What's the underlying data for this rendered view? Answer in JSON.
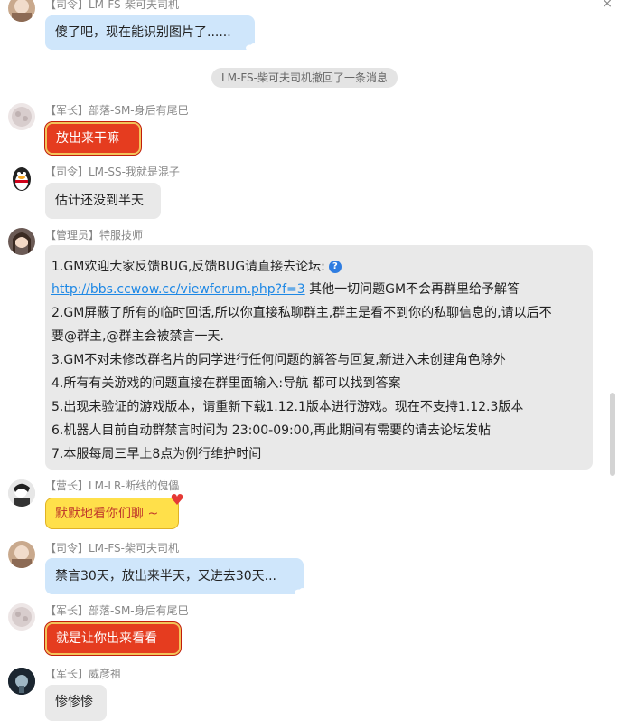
{
  "window": {
    "close_symbol": "×"
  },
  "notice": "LM-FS-柴可夫司机撤回了一条消息",
  "messages": [
    {
      "sender": "【司令】LM-FS-柴可夫司机",
      "text": "傻了吧，现在能识别图片了......"
    },
    {
      "sender": "【军长】部落-SM-身后有尾巴",
      "text": "放出来干嘛"
    },
    {
      "sender": "【司令】LM-SS-我就是混子",
      "text": "估计还没到半天"
    },
    {
      "sender": "【管理员】特服技师"
    },
    {
      "sender": "【营长】LM-LR-断线的傀儡",
      "text": "默默地看你们聊 ~"
    },
    {
      "sender": "【司令】LM-FS-柴可夫司机",
      "text": "禁言30天，放出来半天，又进去30天..."
    },
    {
      "sender": "【军长】部落-SM-身后有尾巴",
      "text": "就是让你出来看看"
    },
    {
      "sender": "【军长】威彦祖",
      "text": "惨惨惨"
    }
  ],
  "announcement": {
    "line1": "1.GM欢迎大家反馈BUG,反馈BUG请直接去论坛:",
    "link": "http://bbs.ccwow.cc/viewforum.php?f=3",
    "line2_rest": " 其他一切问题GM不会再群里给予解答",
    "line3": "2.GM屏蔽了所有的临时回话,所以你直接私聊群主,群主是看不到你的私聊信息的,请以后不",
    "line4": "要@群主,@群主会被禁言一天.",
    "line5": "3.GM不对未修改群名片的同学进行任何问题的解答与回复,新进入未创建角色除外",
    "line6": "4.所有有关游戏的问题直接在群里面输入:导航 都可以找到答案",
    "line7": "5.出现未验证的游戏版本，请重新下载1.12.1版本进行游戏。现在不支持1.12.3版本",
    "line8": "6.机器人目前自动群禁言时间为 23:00-09:00,再此期间有需要的请去论坛发帖",
    "line9": "7.本服每周三早上8点为例行维护时间",
    "question_icon": "?"
  },
  "colors": {
    "blue_bubble": "#cfe6fb",
    "grey_bubble": "#e9e9e9",
    "red_bubble": "#e53c1f",
    "yellow_bubble": "#ffe04a",
    "link": "#1e88e5"
  }
}
